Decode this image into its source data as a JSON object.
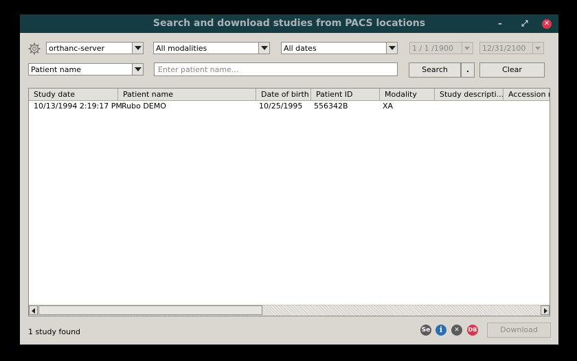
{
  "window": {
    "title": "Search and download studies from PACS locations",
    "minimize_glyph": "–",
    "maximize_glyph": "⤢",
    "close_glyph": "✕"
  },
  "filters": {
    "server": "orthanc-server",
    "modality": "All modalities",
    "dates": "All dates",
    "date_from": "1 / 1 /1900",
    "date_to": "12/31/2100",
    "search_field": "Patient name",
    "search_placeholder": "Enter patient name...",
    "search_label": "Search",
    "options_label": ".",
    "clear_label": "Clear"
  },
  "table": {
    "columns": [
      "Study date",
      "Patient name",
      "Date of birth",
      "Patient ID",
      "Modality",
      "Study descripti...",
      "Accession n"
    ],
    "rows": [
      [
        "10/13/1994 2:19:17 PM",
        "Rubo DEMO",
        "10/25/1995",
        "556342B",
        "XA",
        "",
        ""
      ]
    ]
  },
  "footer": {
    "status": "1 study found",
    "icons": [
      {
        "name": "series-icon",
        "text": "Se",
        "color": "#5b5b5b"
      },
      {
        "name": "info-icon",
        "text": "i",
        "color": "#2a6fb3"
      },
      {
        "name": "clear-icon",
        "text": "✕",
        "color": "#5b5b5b"
      },
      {
        "name": "database-icon",
        "text": "DB",
        "color": "#e0344d"
      }
    ],
    "download_label": "Download"
  },
  "colors": {
    "titlebar": "#163c43",
    "window": "#dad7d1",
    "close": "#e0344d"
  }
}
